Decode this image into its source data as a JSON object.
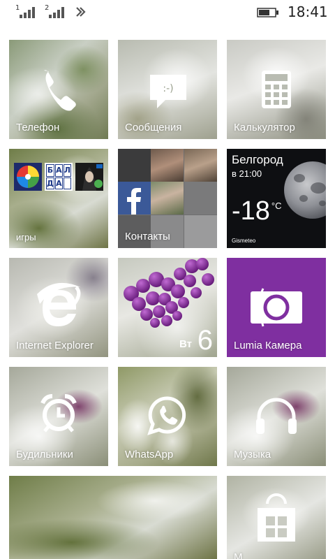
{
  "status_bar": {
    "sim1_label": "1",
    "sim2_label": "2",
    "time": "18:41"
  },
  "tiles": {
    "phone": {
      "label": "Телефон",
      "icon": "phone-icon"
    },
    "messages": {
      "label": "Сообщения",
      "icon": "message-icon"
    },
    "calculator": {
      "label": "Калькулятор",
      "icon": "calculator-icon"
    },
    "games": {
      "label": "игры",
      "icon_bala": [
        "Б",
        "А",
        "Л",
        "Д",
        "А",
        ""
      ]
    },
    "contacts": {
      "label": "Контакты",
      "icon": "facebook-icon"
    },
    "weather": {
      "city": "Белгород",
      "time": "в 21:00",
      "temp": "-18",
      "unit": "°C",
      "source": "Gismeteo"
    },
    "ie": {
      "label": "Internet Explorer",
      "icon": "ie-icon"
    },
    "calendar": {
      "day_name": "Вт",
      "day_num": "6"
    },
    "camera": {
      "label": "Lumia Камера",
      "icon": "camera-icon",
      "color": "#7f2fa0"
    },
    "alarms": {
      "label": "Будильники",
      "icon": "alarm-clock-icon"
    },
    "whatsapp": {
      "label": "WhatsApp",
      "icon": "whatsapp-icon"
    },
    "music": {
      "label": "Музыка",
      "icon": "headphones-icon"
    },
    "store": {
      "label": "М",
      "icon": "store-icon"
    }
  }
}
